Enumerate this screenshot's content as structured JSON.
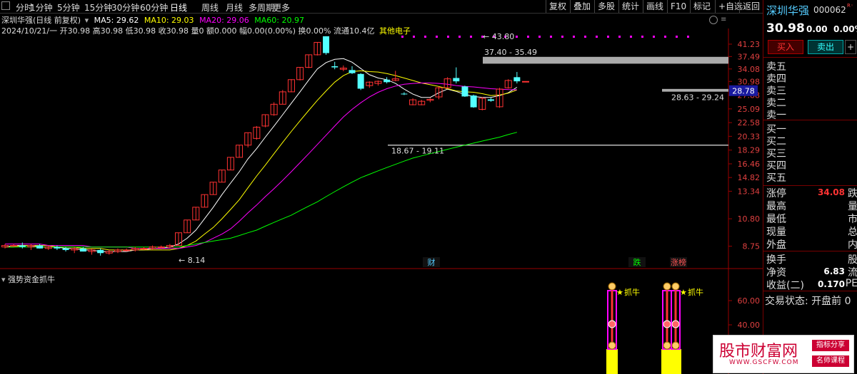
{
  "toolbar": {
    "timeframes": [
      "分时",
      "1分钟",
      "5分钟",
      "15分钟",
      "30分钟",
      "60分钟",
      "日线",
      "周线",
      "月线",
      "多周期",
      "更多"
    ],
    "active_index": 6,
    "right_buttons": [
      "复权",
      "叠加",
      "多股",
      "统计",
      "画线",
      "F10",
      "标记",
      "+自选",
      "返回"
    ]
  },
  "info": {
    "title": "深圳华强(日线 前复权)",
    "ma5": "MA5: 29.62",
    "ma10": "MA10: 29.03",
    "ma20": "MA20: 29.06",
    "ma60": "MA60: 20.97",
    "line2": "2024/10/21/一 开30.98 高30.98 低30.98 收30.98 量0 额0.000 幅0.00(0.00%) 换0.00% 流通10.4亿",
    "sector": "其他电子",
    "colors": {
      "ma5": "#ffffff",
      "ma10": "#ffff00",
      "ma20": "#ff00ff",
      "ma60": "#00ff00"
    }
  },
  "chart_data": [
    {
      "type": "candlestick",
      "title": "深圳华强(日线 前复权)",
      "y_ticks": [
        "41.23",
        "37.49",
        "34.08",
        "30.98",
        "27.88",
        "25.09",
        "22.58",
        "20.33",
        "18.29",
        "16.46",
        "14.82",
        "13.34",
        "10.80",
        "8.75"
      ],
      "current_price_label": "28.78",
      "annotations": [
        "43.80",
        "37.40 - 35.49",
        "28.63 - 29.24",
        "18.67 - 19.11",
        "8.14"
      ],
      "event_markers": [
        "财",
        "跌",
        "涨榜"
      ],
      "candles": [
        {
          "o": 8.7,
          "h": 8.9,
          "l": 8.6,
          "c": 8.8
        },
        {
          "o": 8.8,
          "h": 8.9,
          "l": 8.7,
          "c": 8.8
        },
        {
          "o": 8.8,
          "h": 9.0,
          "l": 8.6,
          "c": 8.7
        },
        {
          "o": 8.7,
          "h": 8.9,
          "l": 8.5,
          "c": 8.8
        },
        {
          "o": 8.8,
          "h": 8.9,
          "l": 8.6,
          "c": 8.6
        },
        {
          "o": 8.6,
          "h": 8.8,
          "l": 8.5,
          "c": 8.7
        },
        {
          "o": 8.7,
          "h": 8.8,
          "l": 8.5,
          "c": 8.6
        },
        {
          "o": 8.6,
          "h": 8.7,
          "l": 8.4,
          "c": 8.5
        },
        {
          "o": 8.5,
          "h": 8.7,
          "l": 8.3,
          "c": 8.6
        },
        {
          "o": 8.6,
          "h": 8.7,
          "l": 8.4,
          "c": 8.4
        },
        {
          "o": 8.4,
          "h": 8.6,
          "l": 8.2,
          "c": 8.5
        },
        {
          "o": 8.5,
          "h": 8.6,
          "l": 8.14,
          "c": 8.3
        },
        {
          "o": 8.3,
          "h": 8.5,
          "l": 8.2,
          "c": 8.4
        },
        {
          "o": 8.4,
          "h": 8.6,
          "l": 8.3,
          "c": 8.5
        },
        {
          "o": 8.5,
          "h": 8.6,
          "l": 8.4,
          "c": 8.5
        },
        {
          "o": 8.5,
          "h": 8.7,
          "l": 8.4,
          "c": 8.6
        },
        {
          "o": 8.6,
          "h": 8.7,
          "l": 8.5,
          "c": 8.6
        },
        {
          "o": 8.6,
          "h": 8.8,
          "l": 8.5,
          "c": 8.7
        },
        {
          "o": 8.7,
          "h": 8.8,
          "l": 8.6,
          "c": 8.7
        },
        {
          "o": 8.7,
          "h": 8.9,
          "l": 8.6,
          "c": 8.8
        },
        {
          "o": 8.8,
          "h": 9.7,
          "l": 8.8,
          "c": 9.7
        },
        {
          "o": 9.7,
          "h": 10.7,
          "l": 9.7,
          "c": 10.7
        },
        {
          "o": 10.7,
          "h": 11.8,
          "l": 10.7,
          "c": 11.8
        },
        {
          "o": 11.8,
          "h": 13.0,
          "l": 11.8,
          "c": 13.0
        },
        {
          "o": 13.0,
          "h": 14.3,
          "l": 13.0,
          "c": 14.3
        },
        {
          "o": 14.3,
          "h": 15.7,
          "l": 14.3,
          "c": 15.7
        },
        {
          "o": 15.7,
          "h": 17.3,
          "l": 15.7,
          "c": 17.3
        },
        {
          "o": 17.3,
          "h": 19.0,
          "l": 17.3,
          "c": 19.0
        },
        {
          "o": 19.0,
          "h": 20.9,
          "l": 18.67,
          "c": 20.9
        },
        {
          "o": 20.0,
          "h": 22.0,
          "l": 19.8,
          "c": 21.8
        },
        {
          "o": 22.0,
          "h": 24.0,
          "l": 21.8,
          "c": 24.0
        },
        {
          "o": 24.0,
          "h": 26.4,
          "l": 23.8,
          "c": 26.0
        },
        {
          "o": 26.0,
          "h": 29.0,
          "l": 26.0,
          "c": 28.6
        },
        {
          "o": 28.6,
          "h": 31.5,
          "l": 28.5,
          "c": 31.4
        },
        {
          "o": 31.4,
          "h": 34.6,
          "l": 31.2,
          "c": 34.5
        },
        {
          "o": 34.5,
          "h": 38.0,
          "l": 34.3,
          "c": 38.0
        },
        {
          "o": 38.0,
          "h": 41.8,
          "l": 37.8,
          "c": 41.8
        },
        {
          "o": 43.8,
          "h": 43.8,
          "l": 38.0,
          "c": 38.5
        },
        {
          "o": 34.8,
          "h": 36.0,
          "l": 34.0,
          "c": 34.5
        },
        {
          "o": 34.0,
          "h": 35.0,
          "l": 33.5,
          "c": 34.3
        },
        {
          "o": 33.8,
          "h": 34.8,
          "l": 32.8,
          "c": 33.0
        },
        {
          "o": 32.8,
          "h": 33.0,
          "l": 29.0,
          "c": 29.3
        },
        {
          "o": 30.0,
          "h": 31.0,
          "l": 29.5,
          "c": 30.8
        },
        {
          "o": 30.5,
          "h": 31.2,
          "l": 30.0,
          "c": 31.0
        },
        {
          "o": 31.4,
          "h": 32.0,
          "l": 30.5,
          "c": 30.8
        },
        {
          "o": 31.2,
          "h": 33.6,
          "l": 31.0,
          "c": 31.6
        },
        {
          "o": 28.2,
          "h": 28.5,
          "l": 27.9,
          "c": 28.1
        },
        {
          "o": 25.9,
          "h": 27.2,
          "l": 25.8,
          "c": 26.9
        },
        {
          "o": 25.9,
          "h": 26.9,
          "l": 25.8,
          "c": 26.6
        },
        {
          "o": 26.8,
          "h": 27.3,
          "l": 26.4,
          "c": 27.0
        },
        {
          "o": 27.5,
          "h": 29.8,
          "l": 27.0,
          "c": 29.5
        },
        {
          "o": 29.5,
          "h": 32.0,
          "l": 29.3,
          "c": 31.6
        },
        {
          "o": 31.8,
          "h": 34.5,
          "l": 30.5,
          "c": 31.0
        },
        {
          "o": 29.8,
          "h": 30.0,
          "l": 27.5,
          "c": 27.6
        },
        {
          "o": 27.8,
          "h": 28.0,
          "l": 25.3,
          "c": 25.4
        },
        {
          "o": 25.0,
          "h": 27.5,
          "l": 24.8,
          "c": 27.2
        },
        {
          "o": 27.0,
          "h": 27.4,
          "l": 26.5,
          "c": 26.7
        },
        {
          "o": 25.5,
          "h": 29.5,
          "l": 25.3,
          "c": 29.2
        },
        {
          "o": 29.5,
          "h": 31.5,
          "l": 29.3,
          "c": 31.2
        },
        {
          "o": 32.0,
          "h": 33.3,
          "l": 30.5,
          "c": 31.0
        },
        {
          "o": 30.98,
          "h": 30.98,
          "l": 30.98,
          "c": 30.98
        }
      ],
      "ma_lines": {
        "ma5": [
          8.7,
          8.8,
          8.8,
          8.8,
          8.7,
          8.7,
          8.7,
          8.6,
          8.6,
          8.5,
          8.5,
          8.4,
          8.4,
          8.4,
          8.4,
          8.5,
          8.5,
          8.6,
          8.6,
          8.7,
          8.9,
          9.3,
          9.9,
          10.8,
          11.8,
          13.0,
          14.2,
          15.5,
          17.1,
          18.5,
          20.2,
          22.0,
          24.0,
          26.2,
          28.6,
          31.3,
          34.1,
          35.8,
          36.7,
          36.9,
          35.9,
          34.2,
          32.6,
          31.8,
          31.4,
          30.5,
          29.2,
          28.1,
          27.4,
          27.4,
          28.4,
          29.2,
          28.7,
          28.0,
          27.6,
          27.4,
          27.4,
          27.8,
          28.4,
          29.62
        ],
        "ma10": [
          8.7,
          8.7,
          8.8,
          8.8,
          8.8,
          8.8,
          8.7,
          8.7,
          8.7,
          8.6,
          8.6,
          8.6,
          8.5,
          8.5,
          8.5,
          8.5,
          8.5,
          8.5,
          8.5,
          8.5,
          8.6,
          8.8,
          9.1,
          9.6,
          10.1,
          10.8,
          11.6,
          12.5,
          13.7,
          15.0,
          16.3,
          17.8,
          19.4,
          21.1,
          22.9,
          24.8,
          26.8,
          28.8,
          30.8,
          32.4,
          33.4,
          33.6,
          33.4,
          33.3,
          32.9,
          32.4,
          31.8,
          31.2,
          30.6,
          30.2,
          29.8,
          29.3,
          28.8,
          28.6,
          28.5,
          28.2,
          27.8,
          27.9,
          28.3,
          29.03
        ],
        "ma20": [
          8.9,
          8.9,
          8.9,
          8.9,
          8.9,
          8.8,
          8.8,
          8.8,
          8.8,
          8.8,
          8.7,
          8.7,
          8.7,
          8.7,
          8.7,
          8.6,
          8.6,
          8.6,
          8.6,
          8.6,
          8.6,
          8.7,
          8.8,
          9.0,
          9.3,
          9.6,
          10.0,
          10.6,
          11.3,
          12.0,
          12.8,
          13.6,
          14.5,
          15.5,
          16.6,
          17.8,
          19.1,
          20.5,
          22.0,
          23.6,
          25.0,
          26.3,
          27.5,
          28.5,
          29.3,
          29.9,
          30.3,
          30.5,
          30.6,
          30.6,
          30.5,
          30.3,
          30.0,
          29.8,
          29.7,
          29.5,
          29.3,
          29.2,
          29.1,
          29.06
        ],
        "ma60": [
          8.7,
          8.7,
          8.7,
          8.7,
          8.7,
          8.7,
          8.7,
          8.7,
          8.7,
          8.7,
          8.7,
          8.7,
          8.7,
          8.7,
          8.7,
          8.7,
          8.7,
          8.7,
          8.7,
          8.7,
          8.7,
          8.8,
          8.9,
          9.0,
          9.1,
          9.2,
          9.3,
          9.5,
          9.7,
          9.9,
          10.2,
          10.5,
          10.8,
          11.1,
          11.5,
          11.9,
          12.3,
          12.8,
          13.3,
          13.8,
          14.3,
          14.8,
          15.2,
          15.6,
          16.0,
          16.4,
          16.8,
          17.2,
          17.5,
          17.8,
          18.1,
          18.4,
          18.7,
          19.0,
          19.3,
          19.6,
          19.9,
          20.2,
          20.6,
          20.97
        ]
      }
    },
    {
      "type": "bar",
      "title": "强势资金抓牛",
      "y_ticks": [
        "60.00",
        "40.00"
      ],
      "signal_label": "抓牛",
      "signals": [
        {
          "index": 49,
          "label": "抓牛"
        },
        {
          "index": 55,
          "label": ""
        },
        {
          "index": 56,
          "label": "抓牛"
        }
      ]
    }
  ],
  "right_panel": {
    "stock_name": "深圳华强",
    "stock_code": "000062",
    "price": "30.98",
    "change": "0.00",
    "change_pct": "0.00%",
    "buy_label": "买入",
    "sell_label": "卖出",
    "plus_label": "+",
    "asks": [
      "卖五",
      "卖四",
      "卖三",
      "卖二",
      "卖一"
    ],
    "bids": [
      "买一",
      "买二",
      "买三",
      "买四",
      "买五"
    ],
    "stats": [
      {
        "label": "涨停",
        "value": "34.08",
        "right": "跌"
      },
      {
        "label": "最高",
        "value": "",
        "right": "量"
      },
      {
        "label": "最低",
        "value": "",
        "right": "市"
      },
      {
        "label": "现量",
        "value": "",
        "right": "总"
      },
      {
        "label": "外盘",
        "value": "",
        "right": "内"
      }
    ],
    "stats2": [
      {
        "label": "换手",
        "value": "",
        "right": "股"
      },
      {
        "label": "净资",
        "value": "6.83",
        "right": "流"
      },
      {
        "label": "收益(二)",
        "value": "0.170",
        "right": "PE"
      }
    ],
    "trade_status": "交易状态: 开盘前 0"
  },
  "watermark": {
    "brand": "股市财富网",
    "url": "WWW.GSCFW.COM",
    "tag1": "指标分享",
    "tag2": "名师课程"
  }
}
